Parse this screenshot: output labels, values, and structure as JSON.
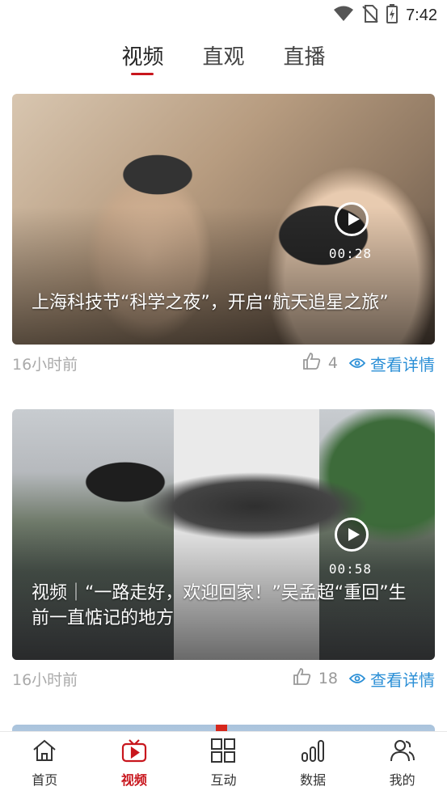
{
  "status_bar": {
    "time": "7:42",
    "icons": [
      "wifi-icon",
      "no-sim-icon",
      "battery-charging-icon"
    ]
  },
  "top_tabs": [
    {
      "label": "视频",
      "active": true
    },
    {
      "label": "直观",
      "active": false
    },
    {
      "label": "直播",
      "active": false
    }
  ],
  "feed": [
    {
      "title": "上海科技节“科学之夜”，开启“航天追星之旅”",
      "duration": "00:28",
      "time_ago": "16小时前",
      "likes": "4",
      "detail_label": "查看详情"
    },
    {
      "title": "视频｜“一路走好，欢迎回家！”吴孟超“重回”生前一直惦记的地方",
      "duration": "00:58",
      "time_ago": "16小时前",
      "likes": "18",
      "detail_label": "查看详情"
    }
  ],
  "bottom_nav": [
    {
      "label": "首页",
      "icon": "home-icon",
      "active": false
    },
    {
      "label": "视频",
      "icon": "tv-icon",
      "active": true
    },
    {
      "label": "互动",
      "icon": "grid-icon",
      "active": false
    },
    {
      "label": "数据",
      "icon": "bar-chart-icon",
      "active": false
    },
    {
      "label": "我的",
      "icon": "user-icon",
      "active": false
    }
  ],
  "colors": {
    "accent": "#c8161d",
    "link": "#2b8fd6",
    "muted": "#aaaaaa"
  }
}
